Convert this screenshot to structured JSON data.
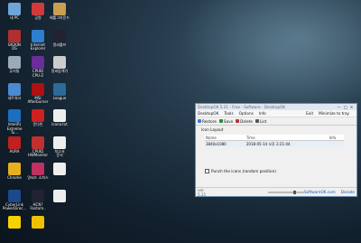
{
  "desktop_icons": [
    {
      "name": "pc",
      "label": "내 PC",
      "color": "#6fa5d8",
      "icon": "computer-icon"
    },
    {
      "name": "hw",
      "label": "공원",
      "color": "#d03a3a",
      "icon": "app-icon"
    },
    {
      "name": "battlegrounds",
      "label": "배틀그라운드",
      "color": "#c8a050",
      "icon": "game-icon"
    },
    {
      "name": "bigkinds",
      "label": "BIGKIN\nDS",
      "color": "#b03030",
      "icon": "app-icon"
    },
    {
      "name": "ie",
      "label": "Internet\nExplorer",
      "color": "#2d7fd0",
      "icon": "ie-icon"
    },
    {
      "name": "camera",
      "label": "알씨툴프",
      "color": "#223",
      "icon": "camera-icon"
    },
    {
      "name": "recycle",
      "label": "휴지통",
      "color": "#9ab",
      "icon": "recycle-bin-icon"
    },
    {
      "name": "cpuz",
      "label": "CPUID\nCPU-Z",
      "color": "#6a2d9a",
      "icon": "cpu-icon"
    },
    {
      "name": "shortcut1",
      "label": "알씨탐색기",
      "color": "#ccc",
      "icon": "app-icon"
    },
    {
      "name": "network",
      "label": "네트워크",
      "color": "#4a8ad0",
      "icon": "network-icon"
    },
    {
      "name": "msi",
      "label": "MSI\nAfterburner",
      "color": "#b01010",
      "icon": "afterburner-icon"
    },
    {
      "name": "league",
      "label": "League",
      "color": "#2b6a9a",
      "icon": "league-icon"
    },
    {
      "name": "intel",
      "label": "Intel(R)\nExtreme Tu...",
      "color": "#1a6fc0",
      "icon": "intel-icon"
    },
    {
      "name": "kakao",
      "label": "문다빈",
      "color": "#d02020",
      "icon": "app-icon"
    },
    {
      "name": "file1",
      "label": "Icona.txt",
      "color": "#eee",
      "icon": "file-icon"
    },
    {
      "name": "aura",
      "label": "AURA",
      "color": "#c02020",
      "icon": "aura-icon"
    },
    {
      "name": "hwmon",
      "label": "CPUID\nHWMonitor",
      "color": "#c03030",
      "icon": "monitor-icon"
    },
    {
      "name": "doc",
      "label": "보고서\n문서",
      "color": "#eee",
      "icon": "document-icon"
    },
    {
      "name": "chrome",
      "label": "Chrome",
      "color": "#e8b020",
      "icon": "chrome-icon"
    },
    {
      "name": "ghost",
      "label": "알씨드 소피스",
      "color": "#c03060",
      "icon": "app-icon"
    },
    {
      "name": "blank",
      "label": "",
      "color": "#eee",
      "icon": "file-icon"
    },
    {
      "name": "cyberlink",
      "label": "CyberLink\nPowerDirec...",
      "color": "#1a4a8a",
      "icon": "cyberlink-icon"
    },
    {
      "name": "hcn",
      "label": "HCN?\nFantom..",
      "color": "#223",
      "icon": "app-icon"
    },
    {
      "name": "file2",
      "label": "",
      "color": "#eee",
      "icon": "file-icon"
    },
    {
      "name": "kakaotalk",
      "label": "",
      "color": "#f5d200",
      "icon": "kakao-icon"
    },
    {
      "name": "three",
      "label": "",
      "color": "#f0c000",
      "icon": "app-icon"
    }
  ],
  "window": {
    "title": "DesktopOK 5.21 - Free - Software - DesktopOK",
    "min": "—",
    "max": "□",
    "close": "✕",
    "menus": [
      "DesktopOK",
      "Tools",
      "Options",
      "Info"
    ],
    "menu_right": [
      "Exit",
      "Minimize to tray"
    ],
    "toolbar": [
      "Restore",
      "Save",
      "Delete",
      "List"
    ],
    "group_label": "Icon Layout",
    "columns": [
      "Name",
      "Time",
      "Info"
    ],
    "rows": [
      {
        "name": "3840x1080",
        "time": "2018-05-14 오후 2:21:44",
        "info": ""
      }
    ],
    "checkbox_label": "Punch the icons (random position)",
    "version": "ver. 5.21",
    "link": "SoftwareOK.com",
    "donate": "Donate"
  }
}
